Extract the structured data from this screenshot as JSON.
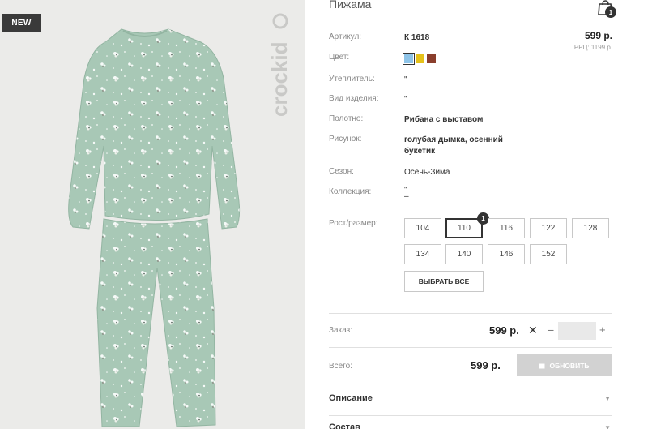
{
  "badge": "NEW",
  "brand": "crockid",
  "product": {
    "title": "Пижама",
    "cart_count": "1",
    "price": "599 р.",
    "rrp": "РРЦ: 1199 р."
  },
  "attributes": [
    {
      "label": "Артикул:",
      "value": "К 1618"
    },
    {
      "label": "Цвет:",
      "value": ""
    },
    {
      "label": "Утеплитель:",
      "value": "\""
    },
    {
      "label": "Вид изделия:",
      "value": "\""
    },
    {
      "label": "Полотно:",
      "value": "Рибана с выставом"
    },
    {
      "label": "Рисунок:",
      "value": "голубая дымка, осенний букетик"
    },
    {
      "label": "Сезон:",
      "value": "Осень-Зима"
    },
    {
      "label": "Коллекция:",
      "value": "\"\n–"
    },
    {
      "label": "Рост/размер:",
      "value": ""
    }
  ],
  "colors": [
    "#8ec4e8",
    "#e6c21a",
    "#8a3e2c"
  ],
  "sizes": [
    {
      "label": "104"
    },
    {
      "label": "110",
      "qty": "1"
    },
    {
      "label": "116"
    },
    {
      "label": "122"
    },
    {
      "label": "128"
    },
    {
      "label": "134"
    },
    {
      "label": "140"
    },
    {
      "label": "146"
    },
    {
      "label": "152"
    }
  ],
  "select_all": "ВЫБРАТЬ ВСЕ",
  "order": {
    "label": "Заказ:",
    "price": "599 р.",
    "quantity": ""
  },
  "total": {
    "label": "Всего:",
    "price": "599 р.",
    "update": "ОБНОВИТЬ"
  },
  "accordion": {
    "description": "Описание",
    "composition": "Состав"
  }
}
